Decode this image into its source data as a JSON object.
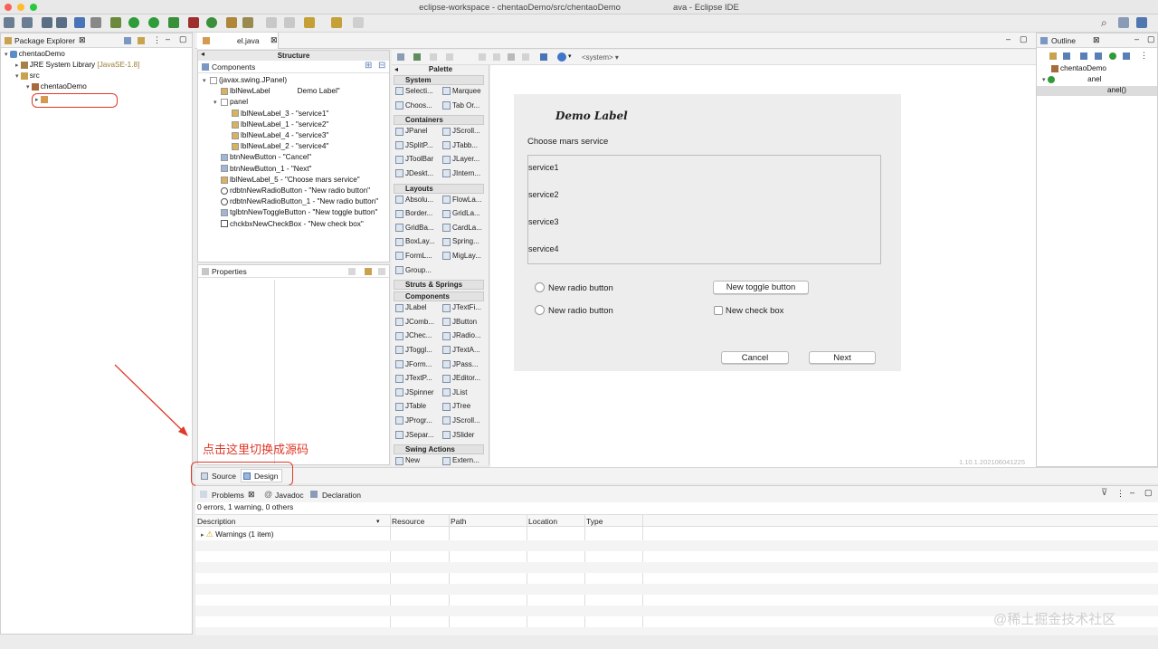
{
  "window": {
    "title_left": "eclipse-workspace - chentaoDemo/src/chentaoDemo",
    "title_right": "ava - Eclipse IDE"
  },
  "package_explorer": {
    "tab_label": "Package Explorer",
    "tree": {
      "project": "chentaoDemo",
      "jre": "JRE System Library",
      "jre_version": "[JavaSE-1.8]",
      "src": "src",
      "package": "chentaoDemo"
    }
  },
  "editor": {
    "tab_label": "el.java"
  },
  "structure": {
    "title": "Structure",
    "components_label": "Components",
    "items": [
      "(javax.swing.JPanel)",
      "lblNewLabel",
      "Demo Label\"",
      "panel",
      "lblNewLabel_3 - \"service1\"",
      "lblNewLabel_1 - \"service2\"",
      "lblNewLabel_4 - \"service3\"",
      "lblNewLabel_2 - \"service4\"",
      "btnNewButton - \"Cancel\"",
      "btnNewButton_1 - \"Next\"",
      "lblNewLabel_5 - \"Choose mars service\"",
      "rdbtnNewRadioButton - \"New radio button\"",
      "rdbtnNewRadioButton_1 - \"New radio button\"",
      "tglbtnNewToggleButton - \"New toggle button\"",
      "chckbxNewCheckBox - \"New check box\""
    ],
    "properties_label": "Properties"
  },
  "palette": {
    "title": "Palette",
    "system_label": "<system>",
    "sections": {
      "system": "System",
      "containers": "Containers",
      "layouts": "Layouts",
      "struts": "Struts & Springs",
      "components": "Components",
      "swing_actions": "Swing Actions"
    },
    "system_items": [
      "Selecti...",
      "Marquee",
      "Choos...",
      "Tab Or..."
    ],
    "container_items": [
      "JPanel",
      "JScroll...",
      "JSplitP...",
      "JTabb...",
      "JToolBar",
      "JLayer...",
      "JDeskt...",
      "JIntern..."
    ],
    "layout_items": [
      "Absolu...",
      "FlowLa...",
      "Border...",
      "GridLa...",
      "GridBa...",
      "CardLa...",
      "BoxLay...",
      "Spring...",
      "FormL...",
      "MigLay...",
      "Group..."
    ],
    "component_items": [
      "JLabel",
      "JTextFi...",
      "JComb...",
      "JButton",
      "JChec...",
      "JRadio...",
      "JToggl...",
      "JTextA...",
      "JForm...",
      "JPass...",
      "JTextP...",
      "JEditor...",
      "JSpinner",
      "JList",
      "JTable",
      "JTree",
      "JProgr...",
      "JScroll...",
      "JSepar...",
      "JSlider"
    ],
    "action_items": [
      "New",
      "Extern..."
    ]
  },
  "design": {
    "demo_label": "Demo Label",
    "choose_label": "Choose mars service",
    "services": [
      "service1",
      "service2",
      "service3",
      "service4"
    ],
    "radio1": "New radio button",
    "radio2": "New radio button",
    "toggle": "New toggle button",
    "checkbox": "New check box",
    "cancel": "Cancel",
    "next": "Next",
    "version": "1.10.1.202106041225"
  },
  "editor_tabs": {
    "source": "Source",
    "design": "Design"
  },
  "annotation": {
    "text": "点击这里切换成源码",
    "color": "#e0382a"
  },
  "outline": {
    "tab_label": "Outline",
    "items": [
      "chentaoDemo",
      "anel",
      "anel()"
    ]
  },
  "problems": {
    "tabs": [
      "Problems",
      "Javadoc",
      "Declaration"
    ],
    "summary": "0 errors, 1 warning, 0 others",
    "columns": [
      "Description",
      "Resource",
      "Path",
      "Location",
      "Type"
    ],
    "warning_row": "Warnings (1 item)"
  },
  "watermark": "@稀土掘金技术社区"
}
